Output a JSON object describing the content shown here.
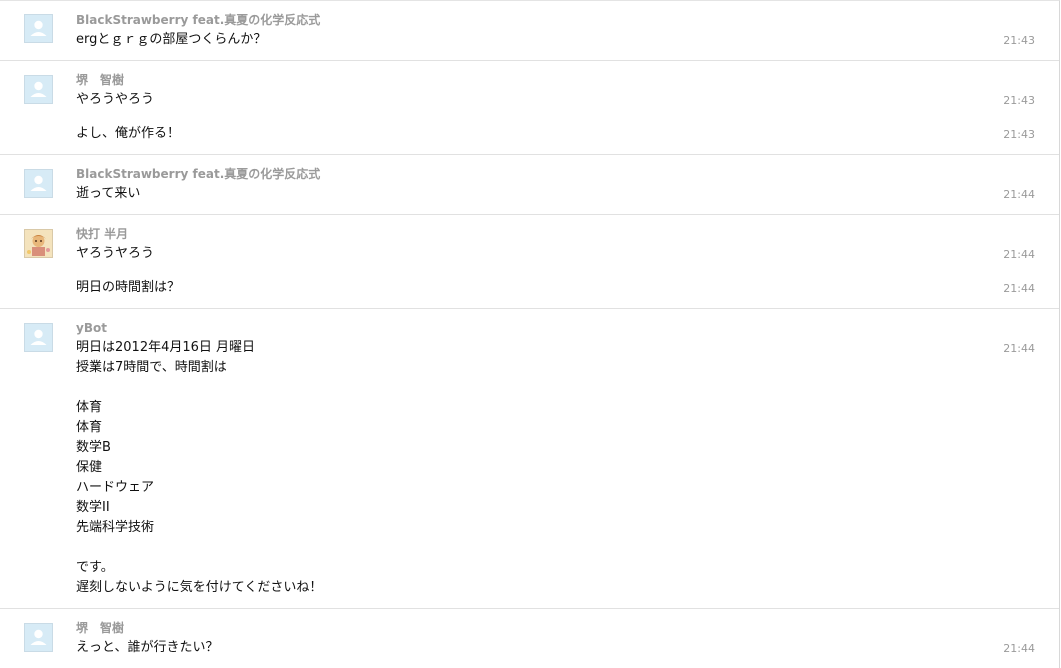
{
  "messages": [
    {
      "sender": "BlackStrawberry feat.真夏の化学反応式",
      "avatar": "default-user-icon",
      "lines": [
        "ergとｇｒｇの部屋つくらんか？"
      ],
      "times": [
        "21:43"
      ]
    },
    {
      "sender": "堺　智樹",
      "avatar": "default-user-icon",
      "lines": [
        "やろうやろう",
        "よし、俺が作る！"
      ],
      "times": [
        "21:43",
        "21:43"
      ]
    },
    {
      "sender": "BlackStrawberry feat.真夏の化学反応式",
      "avatar": "default-user-icon",
      "lines": [
        "逝って来い"
      ],
      "times": [
        "21:44"
      ]
    },
    {
      "sender": "快打 半月",
      "avatar": "custom-avatar-image",
      "lines": [
        "ヤろうヤろう",
        "明日の時間割は？"
      ],
      "times": [
        "21:44",
        "21:44"
      ]
    },
    {
      "sender": "yBot",
      "avatar": "default-user-icon",
      "lines": [
        "明日は2012年4月16日 月曜日",
        "授業は7時間で、時間割は",
        "",
        "体育",
        "体育",
        "数学B",
        "保健",
        "ハードウェア",
        "数学II",
        "先端科学技術",
        "",
        "です。",
        "遅刻しないように気を付けてくださいね！"
      ],
      "times": [
        "21:44"
      ]
    },
    {
      "sender": "堺　智樹",
      "avatar": "default-user-icon",
      "lines": [
        "えっと、誰が行きたい？"
      ],
      "times": [
        "21:44"
      ]
    }
  ]
}
